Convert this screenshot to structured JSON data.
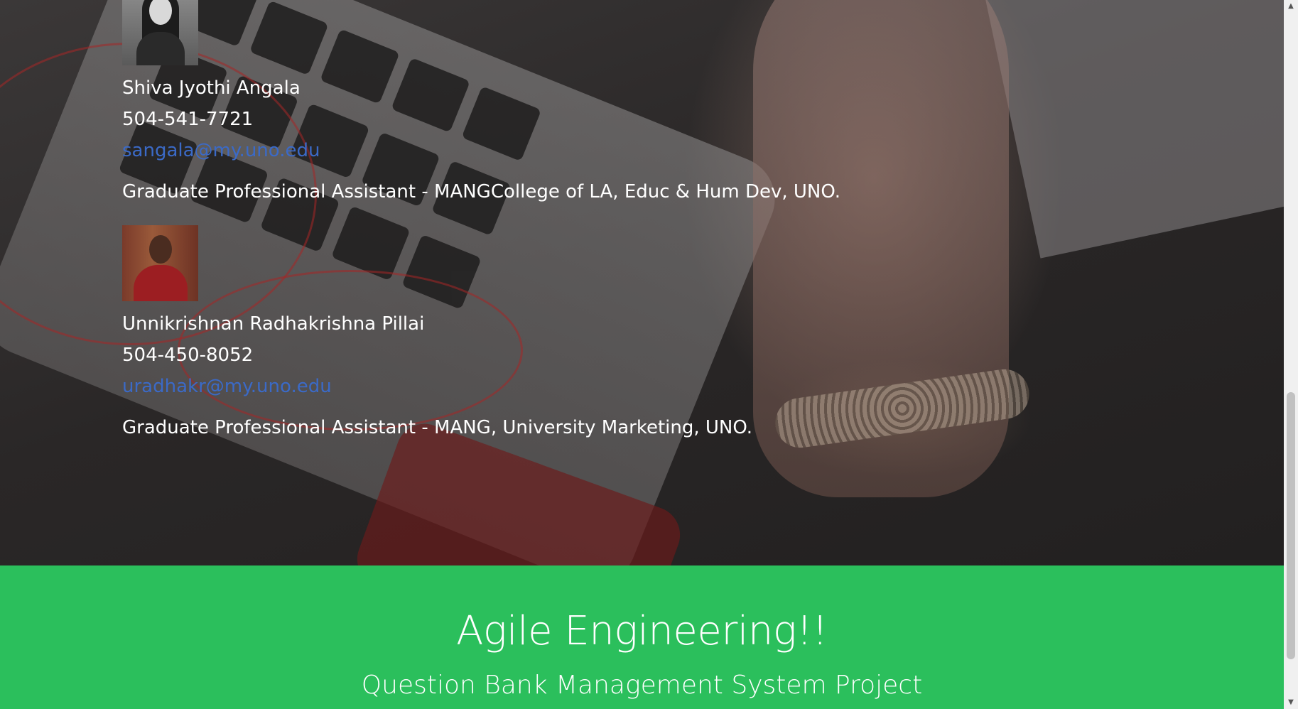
{
  "team": {
    "members": [
      {
        "name": "Shiva Jyothi Angala",
        "phone": "504-541-7721",
        "email": "sangala@my.uno.edu",
        "role": "Graduate Professional Assistant - MANGCollege of LA, Educ & Hum Dev, UNO."
      },
      {
        "name": "Unnikrishnan Radhakrishna Pillai",
        "phone": "504-450-8052",
        "email": "uradhakr@my.uno.edu",
        "role": "Graduate Professional Assistant - MANG, University Marketing, UNO."
      }
    ]
  },
  "footer": {
    "title": "Agile Engineering!!",
    "subtitle": "Question Bank Management System Project",
    "background": "#2bbf5c"
  },
  "colors": {
    "link": "#3b6ac7",
    "text": "#ffffff"
  },
  "icons": {
    "scroll_up": "triangle-up-icon",
    "scroll_down": "triangle-down-icon"
  },
  "scrollbar": {
    "up_glyph": "▲",
    "down_glyph": "▼"
  }
}
